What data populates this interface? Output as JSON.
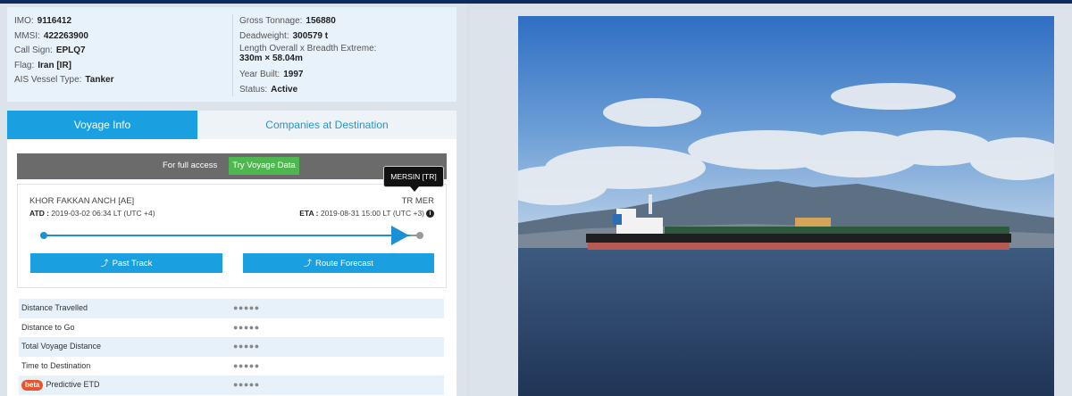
{
  "vessel": {
    "imo_label": "IMO:",
    "imo": "9116412",
    "mmsi_label": "MMSI:",
    "mmsi": "422263900",
    "callsign_label": "Call Sign:",
    "callsign": "EPLQ7",
    "flag_label": "Flag:",
    "flag": "Iran [IR]",
    "type_label": "AIS Vessel Type:",
    "type": "Tanker",
    "gt_label": "Gross Tonnage:",
    "gt": "156880",
    "dwt_label": "Deadweight:",
    "dwt": "300579 t",
    "dims_label": "Length Overall x Breadth Extreme:",
    "dims": "330m × 58.04m",
    "built_label": "Year Built:",
    "built": "1997",
    "status_label": "Status:",
    "status": "Active"
  },
  "tabs": {
    "voyage": "Voyage Info",
    "companies": "Companies at Destination"
  },
  "access": {
    "text": "For full access",
    "button": "Try Voyage Data"
  },
  "route": {
    "from": "KHOR FAKKAN ANCH [AE]",
    "to": "TR MER",
    "atd_label": "ATD :",
    "atd": "2019-03-02 06:34 LT (UTC +4)",
    "eta_label": "ETA :",
    "eta": "2019-08-31 15:00 LT (UTC +3)",
    "past_track": "Past Track",
    "route_forecast": "Route Forecast",
    "tooltip": "MERSIN [TR]"
  },
  "stats": [
    {
      "label": "Distance Travelled",
      "value": "●●●●●"
    },
    {
      "label": "Distance to Go",
      "value": "●●●●●"
    },
    {
      "label": "Total Voyage Distance",
      "value": "●●●●●"
    },
    {
      "label": "Time to Destination",
      "value": "●●●●●"
    },
    {
      "label": "Predictive ETD",
      "value": "●●●●●",
      "badge": "beta"
    }
  ],
  "colors": {
    "accent": "#1aa0e0",
    "green_button": "#4fb74f",
    "beta_badge": "#e8542c",
    "top_bar": "#0f2a5e"
  }
}
